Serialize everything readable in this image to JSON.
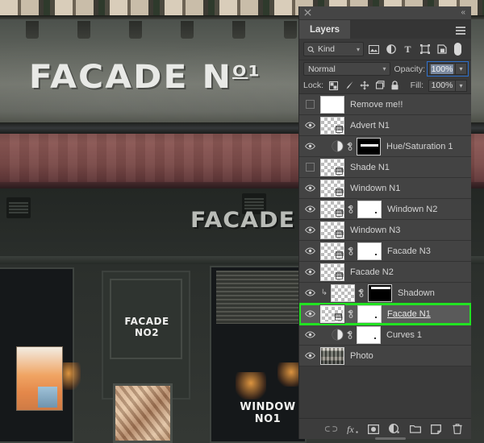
{
  "background_photo": {
    "sign_main": "FACADE N",
    "sign_main_sup": "O1",
    "sign_secondary": "FACADE N",
    "sign_door": "FACADE NO2",
    "sign_window": "WINDOW NO1"
  },
  "panel": {
    "title": "Layers",
    "close_icon": "close-icon",
    "collapse_icon": "collapse-panel-icon",
    "menu_icon": "panel-menu-icon"
  },
  "filter_bar": {
    "kind_label": "Kind",
    "search_icon": "search-icon",
    "chevron": "⌄",
    "icons": [
      {
        "name": "filter-pixel-icon",
        "glyph": "image"
      },
      {
        "name": "filter-adjustment-icon",
        "glyph": "half-circle"
      },
      {
        "name": "filter-type-icon",
        "glyph": "T"
      },
      {
        "name": "filter-shape-icon",
        "glyph": "shape"
      },
      {
        "name": "filter-smartobject-icon",
        "glyph": "smart"
      }
    ],
    "toggle_name": "filter-enable-toggle"
  },
  "blend_bar": {
    "blend_mode": "Normal",
    "opacity_label": "Opacity:",
    "opacity_value": "100%",
    "chevron": "⌄"
  },
  "lock_bar": {
    "lock_label": "Lock:",
    "icons": [
      {
        "name": "lock-transparent-pixels-icon"
      },
      {
        "name": "lock-image-pixels-icon"
      },
      {
        "name": "lock-position-icon"
      },
      {
        "name": "lock-artboard-nesting-icon"
      },
      {
        "name": "lock-all-icon"
      }
    ],
    "fill_label": "Fill:",
    "fill_value": "100%",
    "chevron": "⌄"
  },
  "layers": [
    {
      "name": "Remove me!!",
      "visible": false,
      "thumb": "solid-white",
      "mask": null,
      "clipped": false,
      "selected": false,
      "highlighted": false,
      "renaming": false
    },
    {
      "name": "Advert N1",
      "visible": true,
      "thumb": "smart-checker",
      "mask": null,
      "clipped": false,
      "selected": false,
      "highlighted": false,
      "renaming": false
    },
    {
      "name": "Hue/Saturation 1",
      "visible": true,
      "thumb": "adjustment",
      "mask": "black-stripe",
      "clipped": false,
      "selected": false,
      "highlighted": false,
      "renaming": false
    },
    {
      "name": "Shade N1",
      "visible": false,
      "thumb": "smart-checker",
      "mask": null,
      "clipped": false,
      "selected": false,
      "highlighted": false,
      "renaming": false
    },
    {
      "name": "Windown N1",
      "visible": true,
      "thumb": "smart-checker",
      "mask": null,
      "clipped": false,
      "selected": false,
      "highlighted": false,
      "renaming": false
    },
    {
      "name": "Windown N2",
      "visible": true,
      "thumb": "smart-checker",
      "mask": "white",
      "clipped": false,
      "selected": false,
      "highlighted": false,
      "renaming": false
    },
    {
      "name": "Windown N3",
      "visible": true,
      "thumb": "smart-checker",
      "mask": null,
      "clipped": false,
      "selected": false,
      "highlighted": false,
      "renaming": false
    },
    {
      "name": "Facade N3",
      "visible": true,
      "thumb": "smart-checker",
      "mask": "white",
      "clipped": false,
      "selected": false,
      "highlighted": false,
      "renaming": false
    },
    {
      "name": "Facade N2",
      "visible": true,
      "thumb": "smart-checker",
      "mask": null,
      "clipped": false,
      "selected": false,
      "highlighted": false,
      "renaming": false
    },
    {
      "name": "Shadown",
      "visible": true,
      "thumb": "checker",
      "mask": "black-top",
      "clipped": true,
      "selected": false,
      "highlighted": false,
      "renaming": false
    },
    {
      "name": "Facade N1",
      "visible": true,
      "thumb": "smart-checker",
      "mask": "white",
      "clipped": false,
      "selected": true,
      "highlighted": true,
      "renaming": true
    },
    {
      "name": "Curves 1",
      "visible": true,
      "thumb": "adjustment",
      "mask": "white",
      "clipped": false,
      "selected": false,
      "highlighted": false,
      "renaming": false
    },
    {
      "name": "Photo",
      "visible": true,
      "thumb": "photo",
      "mask": null,
      "clipped": false,
      "selected": false,
      "highlighted": false,
      "renaming": false
    }
  ],
  "bottom_bar": {
    "buttons": [
      {
        "name": "link-layers-button",
        "label": "GO",
        "dim": true
      },
      {
        "name": "layer-style-button",
        "label": "fx",
        "dim": false
      },
      {
        "name": "add-layer-mask-button",
        "label": "mask",
        "dim": false
      },
      {
        "name": "new-adjustment-layer-button",
        "label": "adj",
        "dim": false
      },
      {
        "name": "new-group-button",
        "label": "folder",
        "dim": false
      },
      {
        "name": "new-layer-button",
        "label": "new",
        "dim": false
      },
      {
        "name": "delete-layer-button",
        "label": "trash",
        "dim": false
      }
    ]
  },
  "colors": {
    "panel_bg": "#3a3a3a",
    "row_bg": "#434343",
    "row_selected": "#5a5a5a",
    "highlight_green": "#22e322",
    "focus_blue": "#2c6ecb",
    "text": "#d4d4d4"
  }
}
